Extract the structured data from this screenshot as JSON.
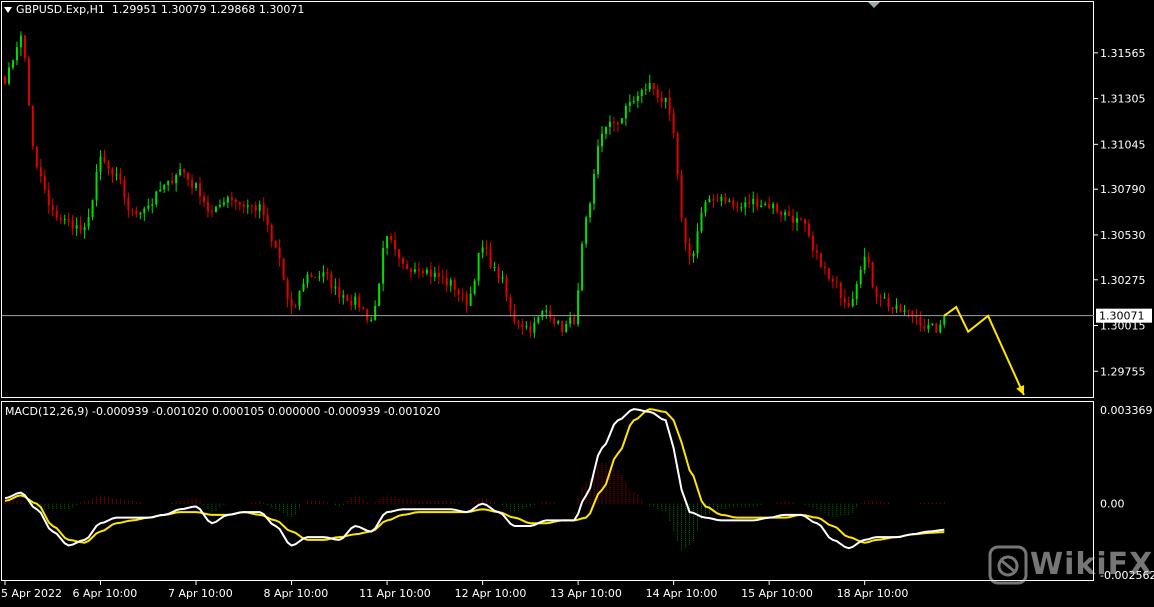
{
  "header": {
    "symbol": "GBPUSD.Exp,H1",
    "ohlc": "1.29951 1.30079 1.29868 1.30071"
  },
  "macd_header": {
    "label": "MACD(12,26,9) -0.000939 -0.001020 0.000105 0.000000 -0.000939 -0.001020"
  },
  "watermark": {
    "text": "WikiFX"
  },
  "colors": {
    "background": "#000000",
    "bull": "#00e000",
    "bear": "#e00000",
    "grid_border": "#ffffff",
    "current_price_line": "#a0a0a0",
    "macd_line": "#ffffff",
    "signal_line": "#ffe600",
    "projection_arrow": "#ffe600"
  },
  "chart_data": [
    {
      "type": "candlestick",
      "title": "GBPUSD.Exp,H1",
      "current_price": 1.30071,
      "current_price_label": "1.30071",
      "ylim": [
        1.2962,
        1.3182
      ],
      "y_ticks": [
        1.31565,
        1.31305,
        1.31045,
        1.3079,
        1.3053,
        1.30275,
        1.30015,
        1.29755
      ],
      "y_tick_labels": [
        "1.31565",
        "1.31305",
        "1.31045",
        "1.30790",
        "1.30530",
        "1.30275",
        "1.30015",
        "1.29755"
      ],
      "x_tick_labels": [
        "5 Apr 2022",
        "6 Apr 10:00",
        "7 Apr 10:00",
        "8 Apr 10:00",
        "11 Apr 10:00",
        "12 Apr 10:00",
        "13 Apr 10:00",
        "14 Apr 10:00",
        "15 Apr 10:00",
        "18 Apr 10:00"
      ],
      "x_tick_bar_index": [
        0,
        24,
        48,
        72,
        96,
        120,
        144,
        168,
        192,
        216
      ],
      "anchors": [
        [
          0,
          1.3142
        ],
        [
          4,
          1.3165
        ],
        [
          8,
          1.309
        ],
        [
          12,
          1.3065
        ],
        [
          16,
          1.306
        ],
        [
          20,
          1.3055
        ],
        [
          24,
          1.3095
        ],
        [
          28,
          1.3085
        ],
        [
          32,
          1.3065
        ],
        [
          36,
          1.307
        ],
        [
          40,
          1.308
        ],
        [
          44,
          1.309
        ],
        [
          48,
          1.308
        ],
        [
          52,
          1.3065
        ],
        [
          56,
          1.3075
        ],
        [
          60,
          1.307
        ],
        [
          64,
          1.3068
        ],
        [
          68,
          1.3045
        ],
        [
          72,
          1.301
        ],
        [
          76,
          1.303
        ],
        [
          80,
          1.303
        ],
        [
          84,
          1.302
        ],
        [
          88,
          1.3015
        ],
        [
          92,
          1.3005
        ],
        [
          96,
          1.305
        ],
        [
          100,
          1.3035
        ],
        [
          104,
          1.3035
        ],
        [
          108,
          1.303
        ],
        [
          112,
          1.3025
        ],
        [
          116,
          1.3015
        ],
        [
          120,
          1.3045
        ],
        [
          124,
          1.303
        ],
        [
          128,
          1.3005
        ],
        [
          132,
          1.3
        ],
        [
          136,
          1.301
        ],
        [
          140,
          1.3
        ],
        [
          143,
          1.3005
        ],
        [
          146,
          1.306
        ],
        [
          150,
          1.3112
        ],
        [
          154,
          1.3118
        ],
        [
          158,
          1.313
        ],
        [
          162,
          1.3138
        ],
        [
          166,
          1.3128
        ],
        [
          168,
          1.311
        ],
        [
          170,
          1.306
        ],
        [
          172,
          1.304
        ],
        [
          176,
          1.307
        ],
        [
          180,
          1.3075
        ],
        [
          184,
          1.3068
        ],
        [
          188,
          1.3072
        ],
        [
          192,
          1.307
        ],
        [
          196,
          1.3065
        ],
        [
          200,
          1.306
        ],
        [
          204,
          1.304
        ],
        [
          208,
          1.3025
        ],
        [
          212,
          1.3015
        ],
        [
          216,
          1.304
        ],
        [
          219,
          1.302
        ],
        [
          224,
          1.301
        ],
        [
          228,
          1.3008
        ],
        [
          232,
          1.3
        ],
        [
          235,
          1.29995
        ],
        [
          236,
          1.30071
        ]
      ],
      "projection": [
        [
          236,
          1.30071
        ],
        [
          239,
          1.3012
        ],
        [
          242,
          1.2998
        ],
        [
          247,
          1.3007
        ],
        [
          256,
          1.2962
        ]
      ]
    },
    {
      "type": "macd",
      "title": "MACD(12,26,9)",
      "ylim": [
        -0.002562,
        0.003369
      ],
      "y_tick_labels": [
        "0.003369",
        "0.00",
        "-0.002562"
      ],
      "y_ticks": [
        0.003369,
        0.0,
        -0.002562
      ],
      "macd_anchors": [
        [
          0,
          0.0002
        ],
        [
          4,
          0.0004
        ],
        [
          8,
          -0.0002
        ],
        [
          12,
          -0.001
        ],
        [
          16,
          -0.0015
        ],
        [
          20,
          -0.0013
        ],
        [
          24,
          -0.0007
        ],
        [
          28,
          -0.0005
        ],
        [
          32,
          -0.0005
        ],
        [
          36,
          -0.0005
        ],
        [
          40,
          -0.0004
        ],
        [
          44,
          -0.0002
        ],
        [
          48,
          -0.0001
        ],
        [
          52,
          -0.0007
        ],
        [
          56,
          -0.0004
        ],
        [
          60,
          -0.0003
        ],
        [
          64,
          -0.0003
        ],
        [
          68,
          -0.0008
        ],
        [
          72,
          -0.0015
        ],
        [
          76,
          -0.0012
        ],
        [
          80,
          -0.0012
        ],
        [
          84,
          -0.0013
        ],
        [
          88,
          -0.0008
        ],
        [
          92,
          -0.001
        ],
        [
          96,
          -0.0003
        ],
        [
          100,
          -0.0002
        ],
        [
          104,
          -0.0002
        ],
        [
          108,
          -0.0002
        ],
        [
          112,
          -0.0002
        ],
        [
          116,
          -0.0003
        ],
        [
          120,
          0.0
        ],
        [
          124,
          -0.0003
        ],
        [
          128,
          -0.0008
        ],
        [
          132,
          -0.0008
        ],
        [
          136,
          -0.0006
        ],
        [
          140,
          -0.0006
        ],
        [
          143,
          -0.0006
        ],
        [
          146,
          0.0003
        ],
        [
          150,
          0.002
        ],
        [
          154,
          0.003
        ],
        [
          158,
          0.0034
        ],
        [
          162,
          0.0033
        ],
        [
          166,
          0.003
        ],
        [
          168,
          0.002
        ],
        [
          170,
          0.0005
        ],
        [
          172,
          -0.0003
        ],
        [
          176,
          -0.0005
        ],
        [
          180,
          -0.0006
        ],
        [
          184,
          -0.0006
        ],
        [
          188,
          -0.0006
        ],
        [
          192,
          -0.0005
        ],
        [
          196,
          -0.0004
        ],
        [
          200,
          -0.0004
        ],
        [
          204,
          -0.0007
        ],
        [
          208,
          -0.0013
        ],
        [
          212,
          -0.0016
        ],
        [
          216,
          -0.0013
        ],
        [
          219,
          -0.0012
        ],
        [
          224,
          -0.0012
        ],
        [
          228,
          -0.0011
        ],
        [
          232,
          -0.001
        ],
        [
          236,
          -0.000939
        ]
      ],
      "signal_anchors": [
        [
          0,
          0.0001
        ],
        [
          4,
          0.0003
        ],
        [
          8,
          0.0
        ],
        [
          12,
          -0.0008
        ],
        [
          16,
          -0.0013
        ],
        [
          20,
          -0.0014
        ],
        [
          24,
          -0.001
        ],
        [
          28,
          -0.0007
        ],
        [
          32,
          -0.0006
        ],
        [
          36,
          -0.0005
        ],
        [
          40,
          -0.0004
        ],
        [
          44,
          -0.0003
        ],
        [
          48,
          -0.0003
        ],
        [
          52,
          -0.0004
        ],
        [
          56,
          -0.0004
        ],
        [
          60,
          -0.0003
        ],
        [
          64,
          -0.0004
        ],
        [
          68,
          -0.0006
        ],
        [
          72,
          -0.001
        ],
        [
          76,
          -0.0013
        ],
        [
          80,
          -0.0013
        ],
        [
          84,
          -0.0012
        ],
        [
          88,
          -0.0011
        ],
        [
          92,
          -0.001
        ],
        [
          96,
          -0.0006
        ],
        [
          100,
          -0.0004
        ],
        [
          104,
          -0.0003
        ],
        [
          108,
          -0.0003
        ],
        [
          112,
          -0.0003
        ],
        [
          116,
          -0.0003
        ],
        [
          120,
          -0.0002
        ],
        [
          124,
          -0.0003
        ],
        [
          128,
          -0.0005
        ],
        [
          132,
          -0.0007
        ],
        [
          136,
          -0.0007
        ],
        [
          140,
          -0.0006
        ],
        [
          143,
          -0.0006
        ],
        [
          146,
          -0.0005
        ],
        [
          150,
          0.0005
        ],
        [
          154,
          0.0018
        ],
        [
          158,
          0.003
        ],
        [
          162,
          0.0034
        ],
        [
          166,
          0.0033
        ],
        [
          168,
          0.003
        ],
        [
          170,
          0.0022
        ],
        [
          172,
          0.0012
        ],
        [
          176,
          -0.0001
        ],
        [
          180,
          -0.0004
        ],
        [
          184,
          -0.0005
        ],
        [
          188,
          -0.0005
        ],
        [
          192,
          -0.0005
        ],
        [
          196,
          -0.0005
        ],
        [
          200,
          -0.0004
        ],
        [
          204,
          -0.0005
        ],
        [
          208,
          -0.0008
        ],
        [
          212,
          -0.0012
        ],
        [
          216,
          -0.0014
        ],
        [
          219,
          -0.0013
        ],
        [
          224,
          -0.0012
        ],
        [
          228,
          -0.0011
        ],
        [
          232,
          -0.00105
        ],
        [
          236,
          -0.00102
        ]
      ]
    }
  ]
}
